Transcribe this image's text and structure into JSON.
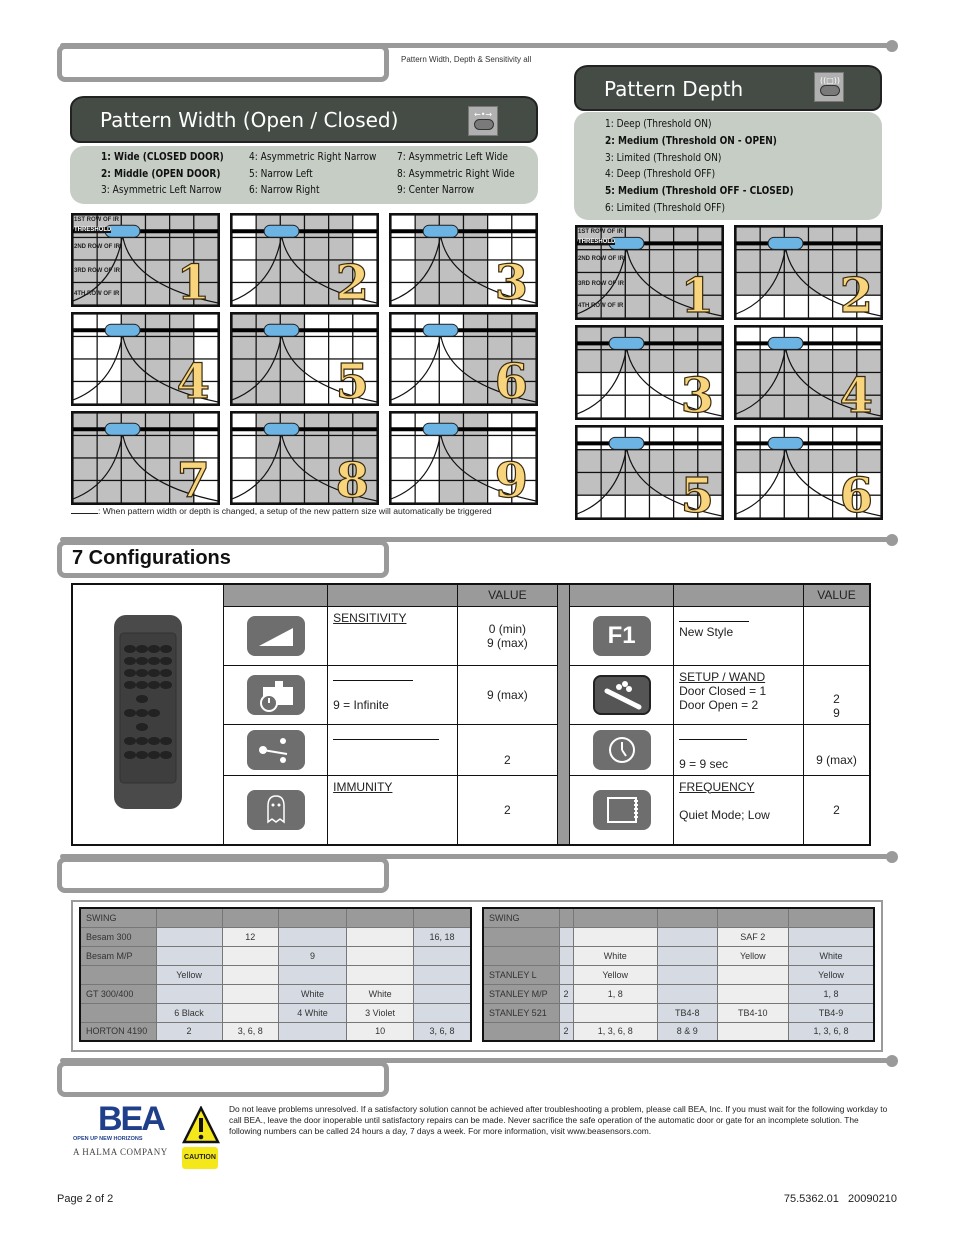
{
  "header_note": "Pattern Width, Depth & Sensitivity all",
  "pattern_width": {
    "title": "Pattern Width (Open / Closed)",
    "icon": "pattern-width-button-icon",
    "options": [
      {
        "label": "1:  Wide (CLOSED DOOR)",
        "bold": true
      },
      {
        "label": "2:  Middle (OPEN DOOR)",
        "bold": true
      },
      {
        "label": "3:  Asymmetric Left Narrow",
        "bold": false
      },
      {
        "label": "4:  Asymmetric Right Narrow",
        "bold": false
      },
      {
        "label": "5:  Narrow Left",
        "bold": false
      },
      {
        "label": "6:  Narrow Right",
        "bold": false
      },
      {
        "label": "7:  Asymmetric Left Wide",
        "bold": false
      },
      {
        "label": "8:  Asymmetric Right Wide",
        "bold": false
      },
      {
        "label": "9:  Center Narrow",
        "bold": false
      }
    ],
    "row_labels": [
      "1ST ROW OF IR",
      "THRESHOLD",
      "2ND ROW OF IR",
      "3RD ROW OF IR",
      "4TH ROW OF IR"
    ],
    "patterns": [
      {
        "number": "1",
        "shaded_columns": [
          0,
          1,
          2,
          3,
          4,
          5
        ]
      },
      {
        "number": "2",
        "shaded_columns": [
          1,
          2,
          3,
          4
        ]
      },
      {
        "number": "3",
        "shaded_columns": [
          1,
          2,
          3
        ]
      },
      {
        "number": "4",
        "shaded_columns": [
          2,
          3,
          4
        ]
      },
      {
        "number": "5",
        "shaded_columns": [
          0,
          1,
          2
        ]
      },
      {
        "number": "6",
        "shaded_columns": [
          3,
          4,
          5
        ]
      },
      {
        "number": "7",
        "shaded_columns": [
          0,
          1,
          2,
          3,
          4
        ]
      },
      {
        "number": "8",
        "shaded_columns": [
          1,
          2,
          3,
          4,
          5
        ]
      },
      {
        "number": "9",
        "shaded_columns": [
          2,
          3
        ]
      }
    ]
  },
  "pattern_depth": {
    "title": "Pattern Depth",
    "icon": "pattern-depth-button-icon",
    "options": [
      {
        "label": "1:  Deep (Threshold ON)",
        "bold": false
      },
      {
        "label": "2:  Medium (Threshold ON - OPEN)",
        "bold": true
      },
      {
        "label": "3:  Limited (Threshold ON)",
        "bold": false
      },
      {
        "label": "4:  Deep (Threshold OFF)",
        "bold": false
      },
      {
        "label": "5:  Medium (Threshold OFF - CLOSED)",
        "bold": true
      },
      {
        "label": "6:  Limited (Threshold OFF)",
        "bold": false
      }
    ],
    "row_labels": [
      "1ST ROW OF IR",
      "THRESHOLD",
      "2ND ROW OF IR",
      "3RD ROW OF IR",
      "4TH ROW OF IR"
    ],
    "patterns": [
      {
        "number": "1",
        "shaded_rows": [
          0,
          1,
          2,
          3
        ]
      },
      {
        "number": "2",
        "shaded_rows": [
          0,
          1,
          2
        ]
      },
      {
        "number": "3",
        "shaded_rows": [
          0,
          1
        ]
      },
      {
        "number": "4",
        "shaded_rows": [
          1,
          2,
          3
        ]
      },
      {
        "number": "5",
        "shaded_rows": [
          1,
          2
        ]
      },
      {
        "number": "6",
        "shaded_rows": [
          1
        ]
      }
    ]
  },
  "pattern_footnote": ":  When pattern width or depth is changed, a setup of the new pattern size will automatically be triggered",
  "configurations": {
    "section_title": "7   Configurations",
    "value_header": "VALUE",
    "left_rows": [
      {
        "icon": "sensitivity-ramp-icon",
        "name": "SENSITIVITY",
        "desc": "",
        "value": "0 (min)\n9 (max)"
      },
      {
        "icon": "presence-timer-icon",
        "name": "",
        "desc": "9 = Infinite",
        "value": "9 (max)"
      },
      {
        "icon": "relay-contact-icon",
        "name": "",
        "desc": "",
        "value": "2"
      },
      {
        "icon": "ghost-immunity-icon",
        "name": "IMMUNITY",
        "desc": "",
        "value": "2"
      }
    ],
    "right_rows": [
      {
        "icon": "f1-key-icon",
        "icon_text": "F1",
        "name": "",
        "desc": "New Style",
        "value": ""
      },
      {
        "icon": "setup-wand-icon",
        "name": "SETUP / WAND",
        "desc": "Door Closed = 1\nDoor Open = 2",
        "value": "2\n9"
      },
      {
        "icon": "clock-icon",
        "name": "",
        "desc": "9 = 9 sec",
        "value": "9 (max)"
      },
      {
        "icon": "frequency-icon",
        "name": "FREQUENCY",
        "desc": "Quiet Mode; Low",
        "value": "2"
      }
    ]
  },
  "door_tables": {
    "left": [
      [
        "SWING",
        "",
        "",
        "",
        "",
        ""
      ],
      [
        "Besam 300",
        "",
        "12",
        "",
        "",
        "16, 18"
      ],
      [
        "Besam M/P",
        "",
        "",
        "9",
        "",
        ""
      ],
      [
        "",
        "Yellow",
        "",
        "",
        "",
        ""
      ],
      [
        "GT 300/400",
        "",
        "",
        "White",
        "White",
        ""
      ],
      [
        "",
        "6 Black",
        "",
        "4 White",
        "3 Violet",
        ""
      ],
      [
        "HORTON 4190",
        "2",
        "3, 6, 8",
        "",
        "10",
        "3, 6, 8"
      ]
    ],
    "right": [
      [
        "SWING",
        "",
        "",
        "",
        "",
        ""
      ],
      [
        "",
        "",
        "",
        "",
        "SAF 2",
        ""
      ],
      [
        "",
        "",
        "White",
        "",
        "Yellow",
        "White"
      ],
      [
        "STANLEY L",
        "",
        "Yellow",
        "",
        "",
        "Yellow"
      ],
      [
        "STANLEY M/P",
        "2",
        "1, 8",
        "",
        "",
        "1, 8"
      ],
      [
        "STANLEY 521",
        "",
        "",
        "TB4-8",
        "TB4-10",
        "TB4-9"
      ],
      [
        "",
        "2",
        "1, 3, 6, 8",
        "8 & 9",
        "",
        "1, 3, 6, 8"
      ]
    ]
  },
  "logo": {
    "brand": "BEA",
    "tagline": "OPEN UP NEW HORIZONS",
    "company": "A HALMA COMPANY",
    "brand_color": "#1f3f8a"
  },
  "caution": {
    "label": "CAUTION",
    "text": "Do not leave problems unresolved. If a satisfactory solution cannot be achieved after troubleshooting a problem, please call BEA, Inc.  If you must wait for the following workday to call BEA., leave the door inoperable until satisfactory repairs can be made.   Never sacrifice the safe operation of the automatic door or gate for an incomplete solution. The following numbers can be called 24 hours a day, 7 days a week.  For more information, visit www.beasensors.com."
  },
  "footer": {
    "page": "Page 2 of 2",
    "doc_id": "75.5362.01   20090210"
  },
  "colors": {
    "shade": "#c0c0c0",
    "sensor": "#6cb4e4",
    "number_fill": "#f8d47c",
    "dark_header": "#454c45",
    "light_panel": "#c5cdc5"
  }
}
